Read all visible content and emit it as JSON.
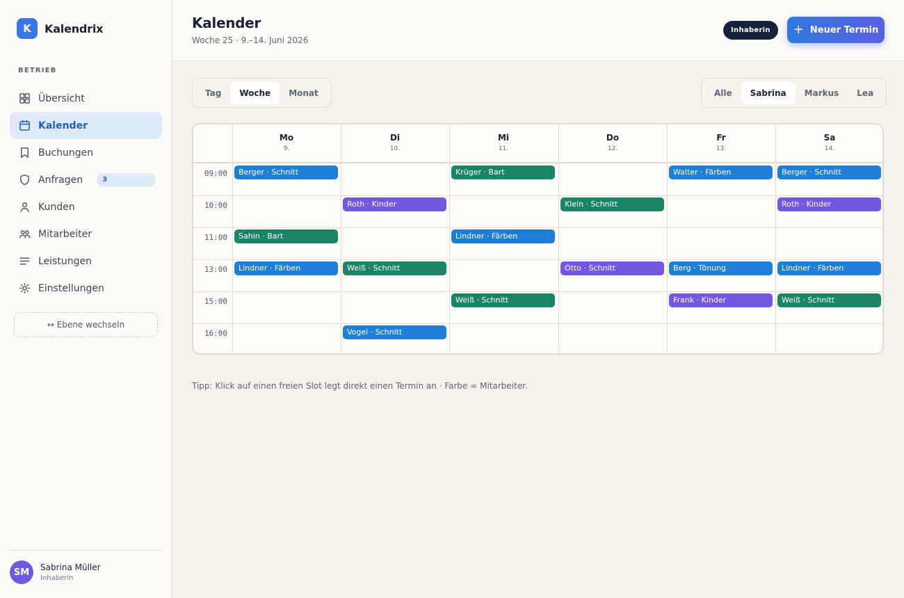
{
  "brand": {
    "logo": "K",
    "name": "Kalendrix"
  },
  "sidebar": {
    "section": "BETRIEB",
    "items": [
      {
        "label": "Übersicht",
        "icon": "grid-icon",
        "active": false
      },
      {
        "label": "Kalender",
        "icon": "calendar-icon",
        "active": true
      },
      {
        "label": "Buchungen",
        "icon": "bookmark-icon",
        "active": false
      },
      {
        "label": "Anfragen",
        "icon": "shield-icon",
        "active": false,
        "badge": "3"
      },
      {
        "label": "Kunden",
        "icon": "user-icon",
        "active": false
      },
      {
        "label": "Mitarbeiter",
        "icon": "users-icon",
        "active": false
      },
      {
        "label": "Leistungen",
        "icon": "list-icon",
        "active": false
      },
      {
        "label": "Einstellungen",
        "icon": "gear-icon",
        "active": false
      }
    ],
    "switch_label": "↔ Ebene wechseln",
    "user": {
      "initials": "SM",
      "name": "Sabrina Müller",
      "role": "Inhaberin"
    }
  },
  "header": {
    "title": "Kalender",
    "subtitle": "Woche 25 · 9.–14. Juni 2026",
    "role_badge": "Inhaberin",
    "new_button": "Neuer Termin"
  },
  "view_tabs": [
    {
      "label": "Tag",
      "active": false
    },
    {
      "label": "Woche",
      "active": true
    },
    {
      "label": "Monat",
      "active": false
    }
  ],
  "staff_filter": [
    {
      "label": "Alle",
      "active": false
    },
    {
      "label": "Sabrina",
      "active": true
    },
    {
      "label": "Markus",
      "active": false
    },
    {
      "label": "Lea",
      "active": false
    }
  ],
  "calendar": {
    "days": [
      {
        "name": "Mo",
        "date": "9."
      },
      {
        "name": "Di",
        "date": "10."
      },
      {
        "name": "Mi",
        "date": "11."
      },
      {
        "name": "Do",
        "date": "12."
      },
      {
        "name": "Fr",
        "date": "13."
      },
      {
        "name": "Sa",
        "date": "14."
      }
    ],
    "times": [
      "09:00",
      "10:00",
      "11:00",
      "13:00",
      "15:00",
      "16:00"
    ],
    "colors": {
      "blue": "#1f7fd6",
      "green": "#1a8467",
      "purple": "#7357e0"
    },
    "events": [
      {
        "day": 0,
        "slot": 0,
        "label": "Berger · Schnitt",
        "color": "blue"
      },
      {
        "day": 2,
        "slot": 0,
        "label": "Krüger · Bart",
        "color": "green"
      },
      {
        "day": 4,
        "slot": 0,
        "label": "Walter · Färben",
        "color": "blue"
      },
      {
        "day": 5,
        "slot": 0,
        "label": "Berger · Schnitt",
        "color": "blue"
      },
      {
        "day": 1,
        "slot": 1,
        "label": "Roth · Kinder",
        "color": "purple"
      },
      {
        "day": 3,
        "slot": 1,
        "label": "Klein · Schnitt",
        "color": "green"
      },
      {
        "day": 5,
        "slot": 1,
        "label": "Roth · Kinder",
        "color": "purple"
      },
      {
        "day": 0,
        "slot": 2,
        "label": "Sahin · Bart",
        "color": "green"
      },
      {
        "day": 2,
        "slot": 2,
        "label": "Lindner · Färben",
        "color": "blue"
      },
      {
        "day": 0,
        "slot": 3,
        "label": "Lindner · Färben",
        "color": "blue"
      },
      {
        "day": 1,
        "slot": 3,
        "label": "Weiß · Schnitt",
        "color": "green"
      },
      {
        "day": 3,
        "slot": 3,
        "label": "Otto · Schnitt",
        "color": "purple"
      },
      {
        "day": 4,
        "slot": 3,
        "label": "Berg · Tönung",
        "color": "blue"
      },
      {
        "day": 5,
        "slot": 3,
        "label": "Lindner · Färben",
        "color": "blue"
      },
      {
        "day": 2,
        "slot": 4,
        "label": "Weiß · Schnitt",
        "color": "green"
      },
      {
        "day": 4,
        "slot": 4,
        "label": "Frank · Kinder",
        "color": "purple"
      },
      {
        "day": 5,
        "slot": 4,
        "label": "Weiß · Schnitt",
        "color": "green"
      },
      {
        "day": 1,
        "slot": 5,
        "label": "Vogel · Schnitt",
        "color": "blue"
      }
    ]
  },
  "tip": "Tipp: Klick auf einen freien Slot legt direkt einen Termin an · Farbe = Mitarbeiter."
}
